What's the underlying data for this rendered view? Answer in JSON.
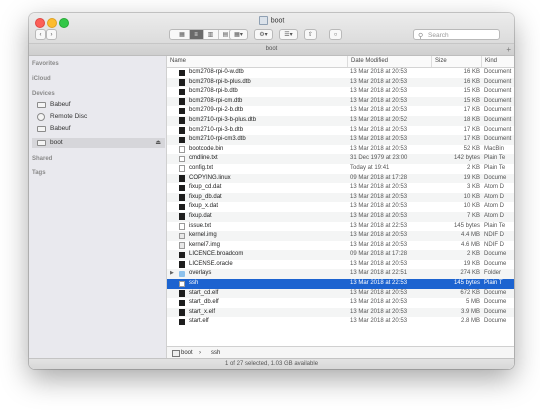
{
  "window": {
    "title": "boot"
  },
  "toolbar": {
    "back": "‹",
    "forward": "›",
    "search_placeholder": "Search"
  },
  "pathbar": {
    "label": "boot",
    "plus": "+"
  },
  "sidebar": {
    "favorites": "Favorites",
    "icloud": "iCloud",
    "devices": "Devices",
    "items": [
      {
        "label": "Babeuf"
      },
      {
        "label": "Remote Disc"
      },
      {
        "label": "Babeuf"
      },
      {
        "label": "boot",
        "eject": "⏏"
      }
    ],
    "shared": "Shared",
    "tags": "Tags"
  },
  "columns": {
    "name": "Name",
    "date": "Date Modified",
    "size": "Size",
    "kind": "Kind"
  },
  "files": [
    {
      "name": "bcm2708-rpi-0-w.dtb",
      "date": "13 Mar 2018 at 20:53",
      "size": "16 KB",
      "kind": "Document",
      "icon": "exec"
    },
    {
      "name": "bcm2708-rpi-b-plus.dtb",
      "date": "13 Mar 2018 at 20:53",
      "size": "16 KB",
      "kind": "Document",
      "icon": "exec"
    },
    {
      "name": "bcm2708-rpi-b.dtb",
      "date": "13 Mar 2018 at 20:53",
      "size": "15 KB",
      "kind": "Document",
      "icon": "exec"
    },
    {
      "name": "bcm2708-rpi-cm.dtb",
      "date": "13 Mar 2018 at 20:53",
      "size": "15 KB",
      "kind": "Document",
      "icon": "exec"
    },
    {
      "name": "bcm2709-rpi-2-b.dtb",
      "date": "13 Mar 2018 at 20:53",
      "size": "17 KB",
      "kind": "Document",
      "icon": "exec"
    },
    {
      "name": "bcm2710-rpi-3-b-plus.dtb",
      "date": "13 Mar 2018 at 20:52",
      "size": "18 KB",
      "kind": "Document",
      "icon": "exec"
    },
    {
      "name": "bcm2710-rpi-3-b.dtb",
      "date": "13 Mar 2018 at 20:53",
      "size": "17 KB",
      "kind": "Document",
      "icon": "exec"
    },
    {
      "name": "bcm2710-rpi-cm3.dtb",
      "date": "13 Mar 2018 at 20:53",
      "size": "17 KB",
      "kind": "Document",
      "icon": "exec"
    },
    {
      "name": "bootcode.bin",
      "date": "13 Mar 2018 at 20:53",
      "size": "52 KB",
      "kind": "MacBin",
      "icon": "doc"
    },
    {
      "name": "cmdline.txt",
      "date": "31 Dec 1979 at 23:00",
      "size": "142 bytes",
      "kind": "Plain Te",
      "icon": "doc"
    },
    {
      "name": "config.txt",
      "date": "Today at 19:41",
      "size": "2 KB",
      "kind": "Plain Te",
      "icon": "doc"
    },
    {
      "name": "COPYING.linux",
      "date": "09 Mar 2018 at 17:28",
      "size": "19 KB",
      "kind": "Docume",
      "icon": "exec"
    },
    {
      "name": "fixup_cd.dat",
      "date": "13 Mar 2018 at 20:53",
      "size": "3 KB",
      "kind": "Atom D",
      "icon": "exec"
    },
    {
      "name": "fixup_db.dat",
      "date": "13 Mar 2018 at 20:53",
      "size": "10 KB",
      "kind": "Atom D",
      "icon": "exec"
    },
    {
      "name": "fixup_x.dat",
      "date": "13 Mar 2018 at 20:53",
      "size": "10 KB",
      "kind": "Atom D",
      "icon": "exec"
    },
    {
      "name": "fixup.dat",
      "date": "13 Mar 2018 at 20:53",
      "size": "7 KB",
      "kind": "Atom D",
      "icon": "exec"
    },
    {
      "name": "issue.txt",
      "date": "13 Mar 2018 at 22:53",
      "size": "145 bytes",
      "kind": "Plain Te",
      "icon": "doc"
    },
    {
      "name": "kernel.img",
      "date": "13 Mar 2018 at 20:53",
      "size": "4.4 MB",
      "kind": "NDIF D",
      "icon": "lock"
    },
    {
      "name": "kernel7.img",
      "date": "13 Mar 2018 at 20:53",
      "size": "4.6 MB",
      "kind": "NDIF D",
      "icon": "lock"
    },
    {
      "name": "LICENCE.broadcom",
      "date": "09 Mar 2018 at 17:28",
      "size": "2 KB",
      "kind": "Docume",
      "icon": "exec"
    },
    {
      "name": "LICENSE.oracle",
      "date": "13 Mar 2018 at 20:53",
      "size": "19 KB",
      "kind": "Docume",
      "icon": "exec"
    },
    {
      "name": "overlays",
      "date": "13 Mar 2018 at 22:51",
      "size": "274 KB",
      "kind": "Folder",
      "icon": "folder",
      "folder": true
    },
    {
      "name": "ssh",
      "date": "13 Mar 2018 at 22:53",
      "size": "145 bytes",
      "kind": "Plain T",
      "icon": "doc",
      "selected": true
    },
    {
      "name": "start_cd.elf",
      "date": "13 Mar 2018 at 20:53",
      "size": "672 KB",
      "kind": "Docume",
      "icon": "exec"
    },
    {
      "name": "start_db.elf",
      "date": "13 Mar 2018 at 20:53",
      "size": "5 MB",
      "kind": "Docume",
      "icon": "exec"
    },
    {
      "name": "start_x.elf",
      "date": "13 Mar 2018 at 20:53",
      "size": "3.9 MB",
      "kind": "Docume",
      "icon": "exec"
    },
    {
      "name": "start.elf",
      "date": "13 Mar 2018 at 20:53",
      "size": "2.8 MB",
      "kind": "Docume",
      "icon": "exec"
    }
  ],
  "path": {
    "root": "boot",
    "sep": "›",
    "item": "ssh"
  },
  "status": "1 of 27 selected, 1.03 GB available"
}
